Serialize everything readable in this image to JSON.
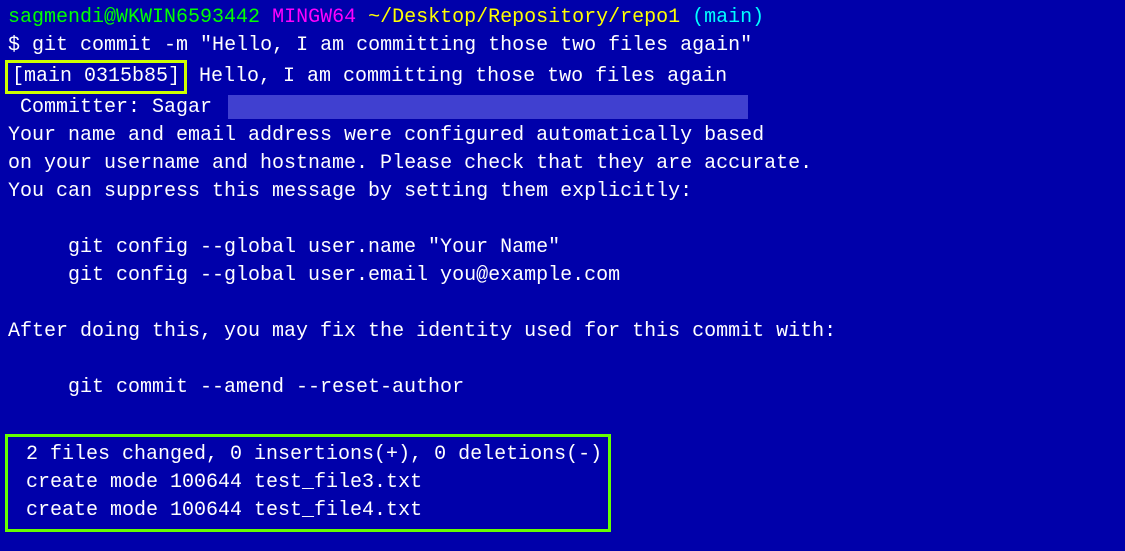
{
  "prompt": {
    "user": "sagmendi@WKWIN6593442",
    "mingw": "MINGW64",
    "path": "~/Desktop/Repository/repo1",
    "branch": "(main)",
    "dollar": "$",
    "command": "git commit -m \"Hello, I am committing those two files again\""
  },
  "output": {
    "commit_ref": "[main 0315b85]",
    "commit_msg": " Hello, I am committing those two files again",
    "committer_label": " Committer: Sagar ",
    "info1": "Your name and email address were configured automatically based",
    "info2": "on your username and hostname. Please check that they are accurate.",
    "info3": "You can suppress this message by setting them explicitly:",
    "config1": "git config --global user.name \"Your Name\"",
    "config2": "git config --global user.email you@example.com",
    "info4": "After doing this, you may fix the identity used for this commit with:",
    "amend": "git commit --amend --reset-author",
    "summary1": " 2 files changed, 0 insertions(+), 0 deletions(-)",
    "summary2": " create mode 100644 test_file3.txt",
    "summary3": " create mode 100644 test_file4.txt"
  }
}
